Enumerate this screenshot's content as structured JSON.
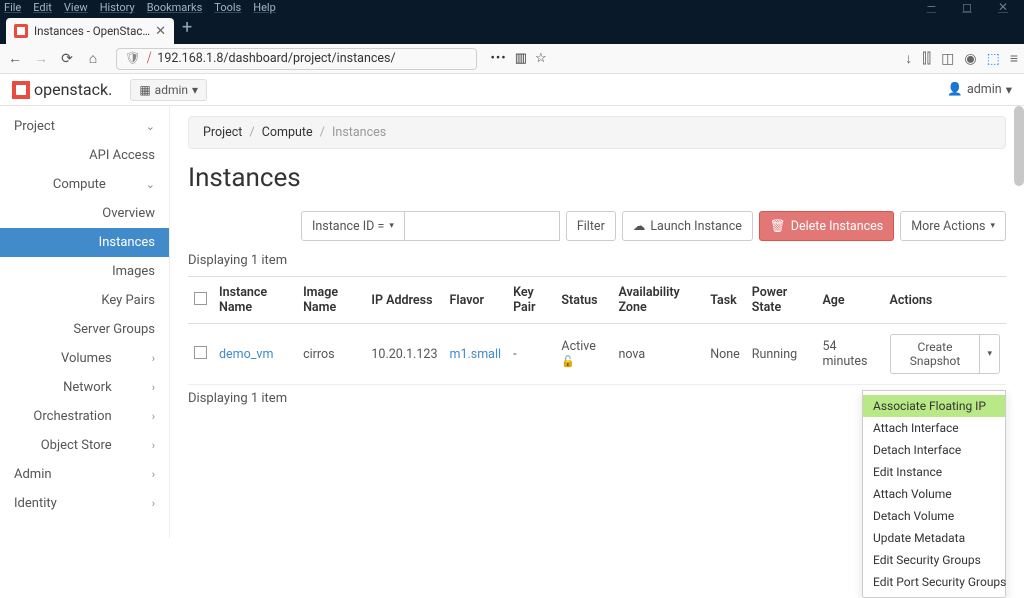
{
  "browser_menu": [
    "File",
    "Edit",
    "View",
    "History",
    "Bookmarks",
    "Tools",
    "Help"
  ],
  "tab": {
    "title": "Instances - OpenStack Dashbo..."
  },
  "url": "192.168.1.8/dashboard/project/instances/",
  "header": {
    "brand": "openstack.",
    "domain_label": "admin",
    "user_label": "admin"
  },
  "sidebar": {
    "project": "Project",
    "api_access": "API Access",
    "compute": "Compute",
    "overview": "Overview",
    "instances": "Instances",
    "images": "Images",
    "key_pairs": "Key Pairs",
    "server_groups": "Server Groups",
    "volumes": "Volumes",
    "network": "Network",
    "orchestration": "Orchestration",
    "object_store": "Object Store",
    "admin": "Admin",
    "identity": "Identity"
  },
  "breadcrumb": {
    "a": "Project",
    "b": "Compute",
    "c": "Instances"
  },
  "page_title": "Instances",
  "toolbar": {
    "filter_field": "Instance ID =",
    "filter_btn": "Filter",
    "launch": "Launch Instance",
    "delete": "Delete Instances",
    "more": "More Actions"
  },
  "displaying": "Displaying 1 item",
  "columns": {
    "name": "Instance Name",
    "image": "Image Name",
    "ip": "IP Address",
    "flavor": "Flavor",
    "keypair": "Key Pair",
    "status": "Status",
    "az": "Availability Zone",
    "task": "Task",
    "power": "Power State",
    "age": "Age",
    "actions": "Actions"
  },
  "row": {
    "name": "demo_vm",
    "image": "cirros",
    "ip": "10.20.1.123",
    "flavor": "m1.small",
    "keypair": "-",
    "status": "Active",
    "az": "nova",
    "task": "None",
    "power": "Running",
    "age": "54 minutes",
    "action_btn": "Create Snapshot"
  },
  "dropdown": [
    "Associate Floating IP",
    "Attach Interface",
    "Detach Interface",
    "Edit Instance",
    "Attach Volume",
    "Detach Volume",
    "Update Metadata",
    "Edit Security Groups",
    "Edit Port Security Groups"
  ]
}
